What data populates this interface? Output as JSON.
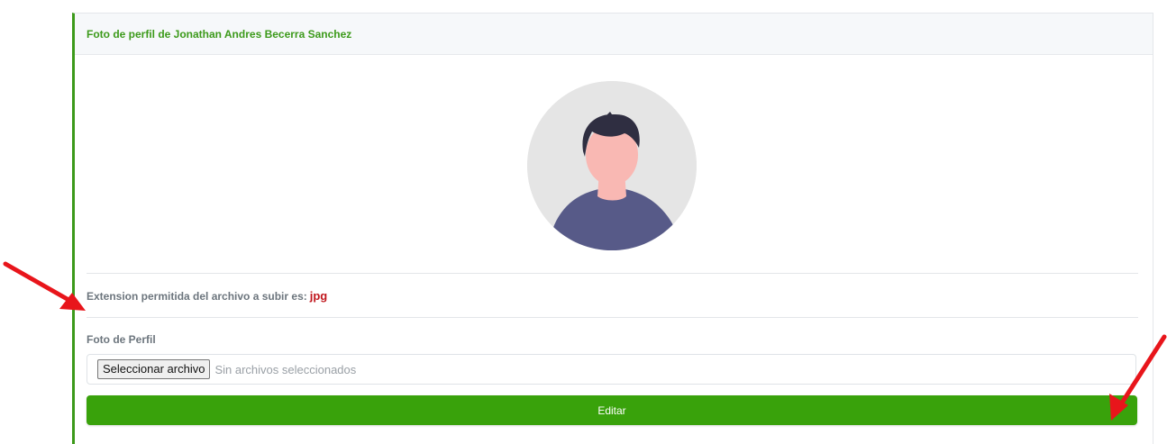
{
  "card": {
    "title": "Foto de perfil de Jonathan Andres Becerra Sanchez"
  },
  "avatar": {
    "icon": "person-avatar-icon"
  },
  "info": {
    "extension_label": "Extension permitida del archivo a subir es:",
    "extension_value": "jpg"
  },
  "upload": {
    "label": "Foto de Perfil",
    "button_label": "Seleccionar archivo",
    "status_text": "Sin archivos seleccionados"
  },
  "submit": {
    "label": "Editar"
  },
  "colors": {
    "accent_green": "#3c9a1a",
    "button_green": "#39a20b",
    "extension_red": "#c0161c",
    "annotation_arrow": "#e8151b"
  }
}
